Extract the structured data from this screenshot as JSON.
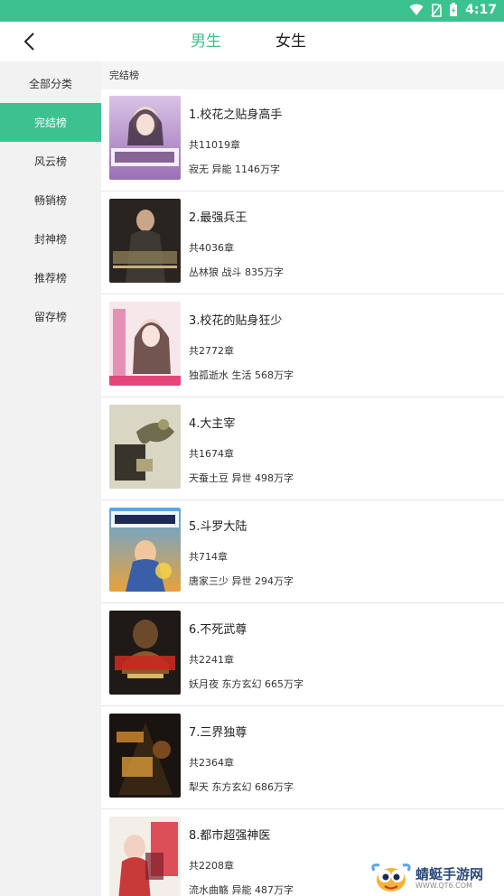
{
  "status_bar": {
    "time": "4:17",
    "icons": [
      "wifi-icon",
      "no-sim-icon",
      "battery-charging-icon"
    ]
  },
  "header": {
    "back_icon": "chevron-left-icon",
    "tabs": [
      "男生",
      "女生"
    ],
    "active_tab": "男生"
  },
  "sidebar": {
    "items": [
      "全部分类",
      "完结榜",
      "风云榜",
      "畅销榜",
      "封神榜",
      "推荐榜",
      "留存榜"
    ],
    "active_index": 1
  },
  "section": {
    "title": "完结榜"
  },
  "books": [
    {
      "title": "1.校花之贴身高手",
      "chapters": "共11019章",
      "meta": "寂无 异能 1146万字"
    },
    {
      "title": "2.最强兵王",
      "chapters": "共4036章",
      "meta": "丛林狼 战斗 835万字"
    },
    {
      "title": "3.校花的贴身狂少",
      "chapters": "共2772章",
      "meta": "独孤逝水 生活 568万字"
    },
    {
      "title": "4.大主宰",
      "chapters": "共1674章",
      "meta": "天蚕土豆 异世 498万字"
    },
    {
      "title": "5.斗罗大陆",
      "chapters": "共714章",
      "meta": "唐家三少 异世 294万字"
    },
    {
      "title": "6.不死武尊",
      "chapters": "共2241章",
      "meta": "妖月夜 东方玄幻 665万字"
    },
    {
      "title": "7.三界独尊",
      "chapters": "共2364章",
      "meta": "犁天 东方玄幻 686万字"
    },
    {
      "title": "8.都市超强神医",
      "chapters": "共2208章",
      "meta": "流水曲觞 异能 487万字"
    }
  ],
  "colors": {
    "accent": "#3cc28f",
    "sidebar_bg": "#f2f2f2",
    "divider": "#e6e6e6"
  },
  "watermark": {
    "text": "蜻蜓手游网",
    "url": "WWW.QT6.COM"
  }
}
